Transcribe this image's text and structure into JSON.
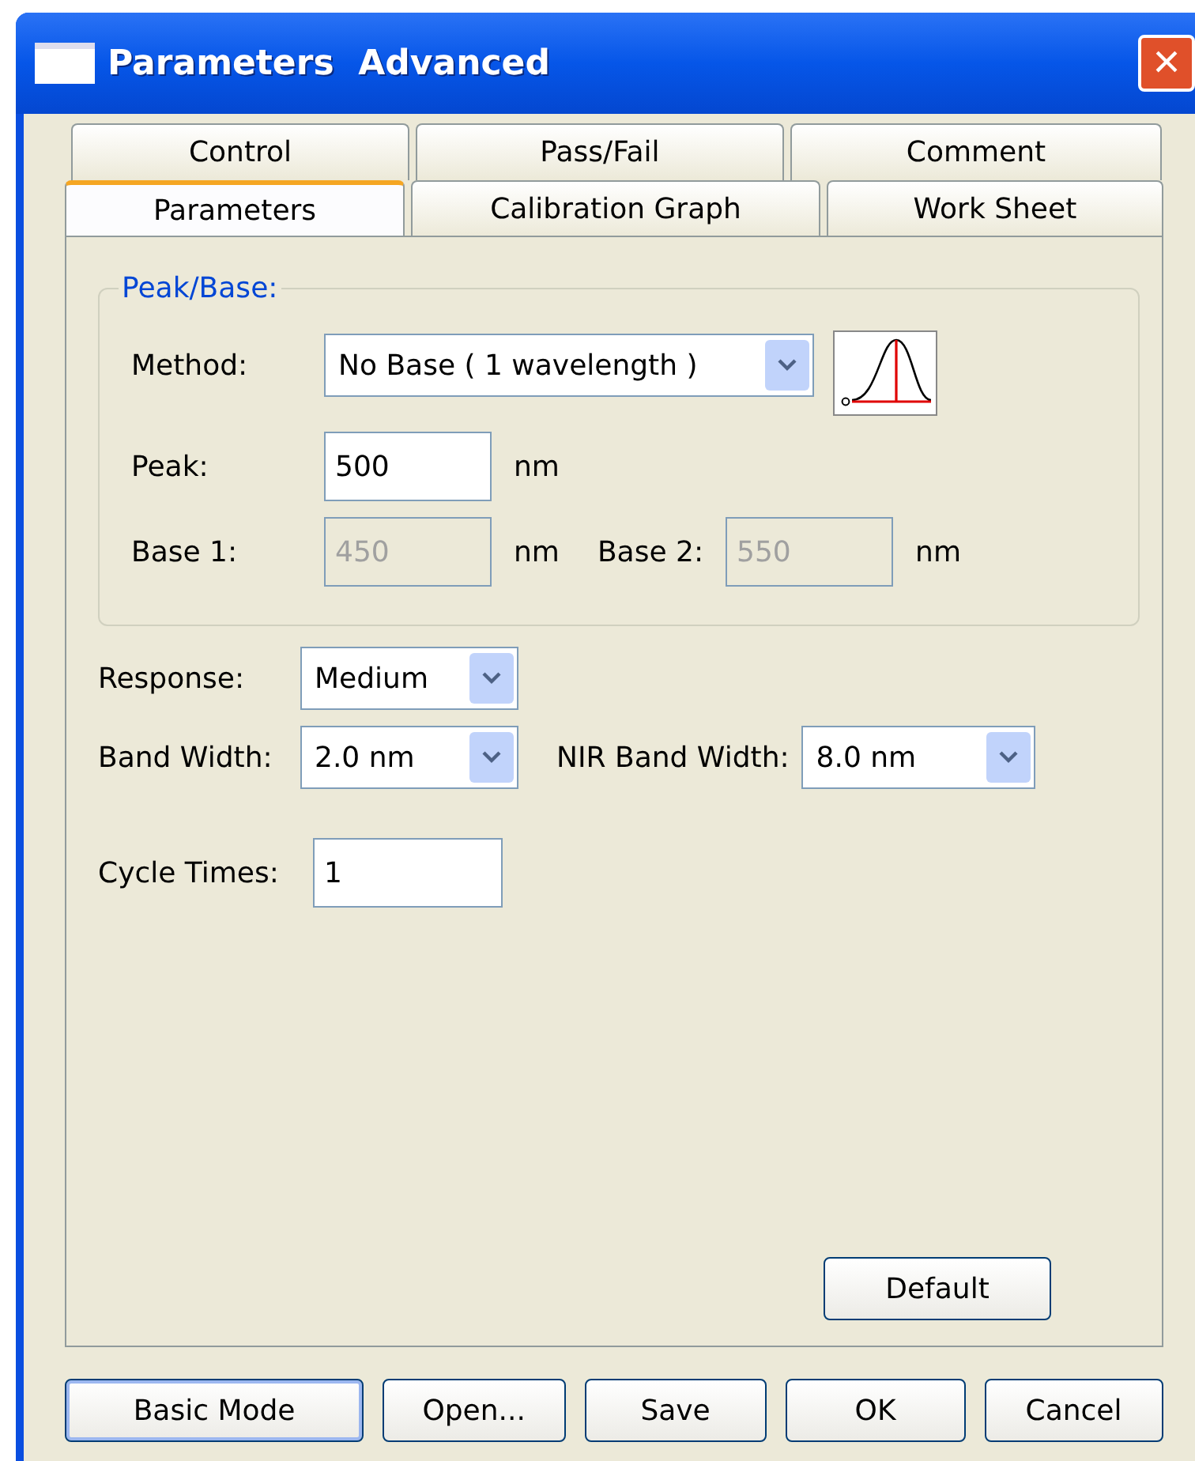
{
  "window": {
    "title": "Parameters  Advanced",
    "close": "×"
  },
  "tab_rows": [
    {
      "tabs": [
        {
          "label": "Control",
          "selected": false
        },
        {
          "label": "Pass/Fail",
          "selected": false
        },
        {
          "label": "Comment",
          "selected": false
        }
      ]
    },
    {
      "tabs": [
        {
          "label": "Parameters",
          "selected": true
        },
        {
          "label": "Calibration Graph",
          "selected": false
        },
        {
          "label": "Work Sheet",
          "selected": false
        }
      ]
    }
  ],
  "peak_base": {
    "legend": "Peak/Base:",
    "method": {
      "label": "Method:",
      "value": "No Base ( 1 wavelength )"
    },
    "peak": {
      "label": "Peak:",
      "value": "500",
      "unit": "nm",
      "disabled": false
    },
    "base_1": {
      "label": "Base 1:",
      "value": "450",
      "unit": "nm",
      "disabled": true
    },
    "base_2": {
      "label": "Base 2:",
      "value": "550",
      "unit": "nm",
      "disabled": true
    }
  },
  "response": {
    "label": "Response:",
    "value": "Medium"
  },
  "band_width": {
    "label": "Band Width:",
    "value": "2.0 nm"
  },
  "nir_band_width": {
    "label": "NIR Band Width:",
    "value": "8.0 nm"
  },
  "cycle_times": {
    "label": "Cycle Times:",
    "value": "1"
  },
  "default_button": "Default",
  "buttons": [
    {
      "label": "Basic Mode",
      "selected": true
    },
    {
      "label": "Open...",
      "selected": false
    },
    {
      "label": "Save",
      "selected": false
    },
    {
      "label": "OK",
      "selected": false
    },
    {
      "label": "Cancel",
      "selected": false
    }
  ]
}
